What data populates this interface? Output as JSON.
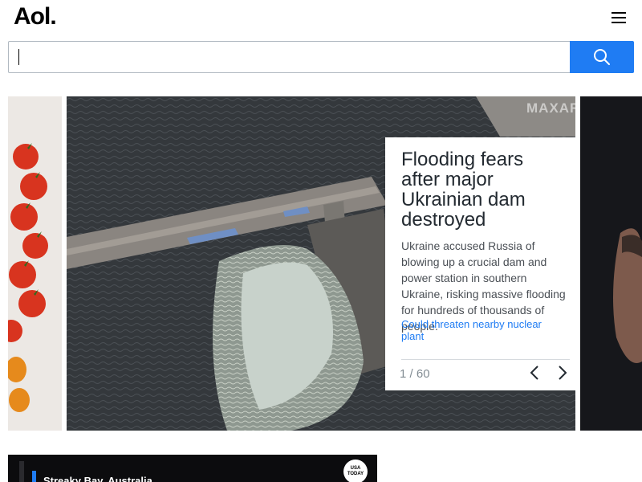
{
  "header": {
    "logo_text": "Aol.",
    "menu_icon": "hamburger-menu-icon"
  },
  "search": {
    "value": "",
    "placeholder": "",
    "button_icon": "search-icon",
    "button_color": "#1f7cf3"
  },
  "carousel": {
    "main": {
      "watermark": "MAXAR",
      "title": "Flooding fears after major Ukrainian dam destroyed",
      "summary": "Ukraine accused Russia of blowing up a crucial dam and power station in southern Ukraine, risking massive flooding for hundreds of thousands of people.",
      "link_text": "Could threaten nearby nuclear plant",
      "current_index": "1",
      "separator": "/",
      "total": "60",
      "prev_icon": "chevron-left-icon",
      "next_icon": "chevron-right-icon"
    }
  },
  "video": {
    "title": "Streaky Bay, Australia",
    "badge_line1": "USA",
    "badge_line2": "TODAY"
  },
  "colors": {
    "accent": "#1f7cf3",
    "link": "#1f7cf3"
  }
}
